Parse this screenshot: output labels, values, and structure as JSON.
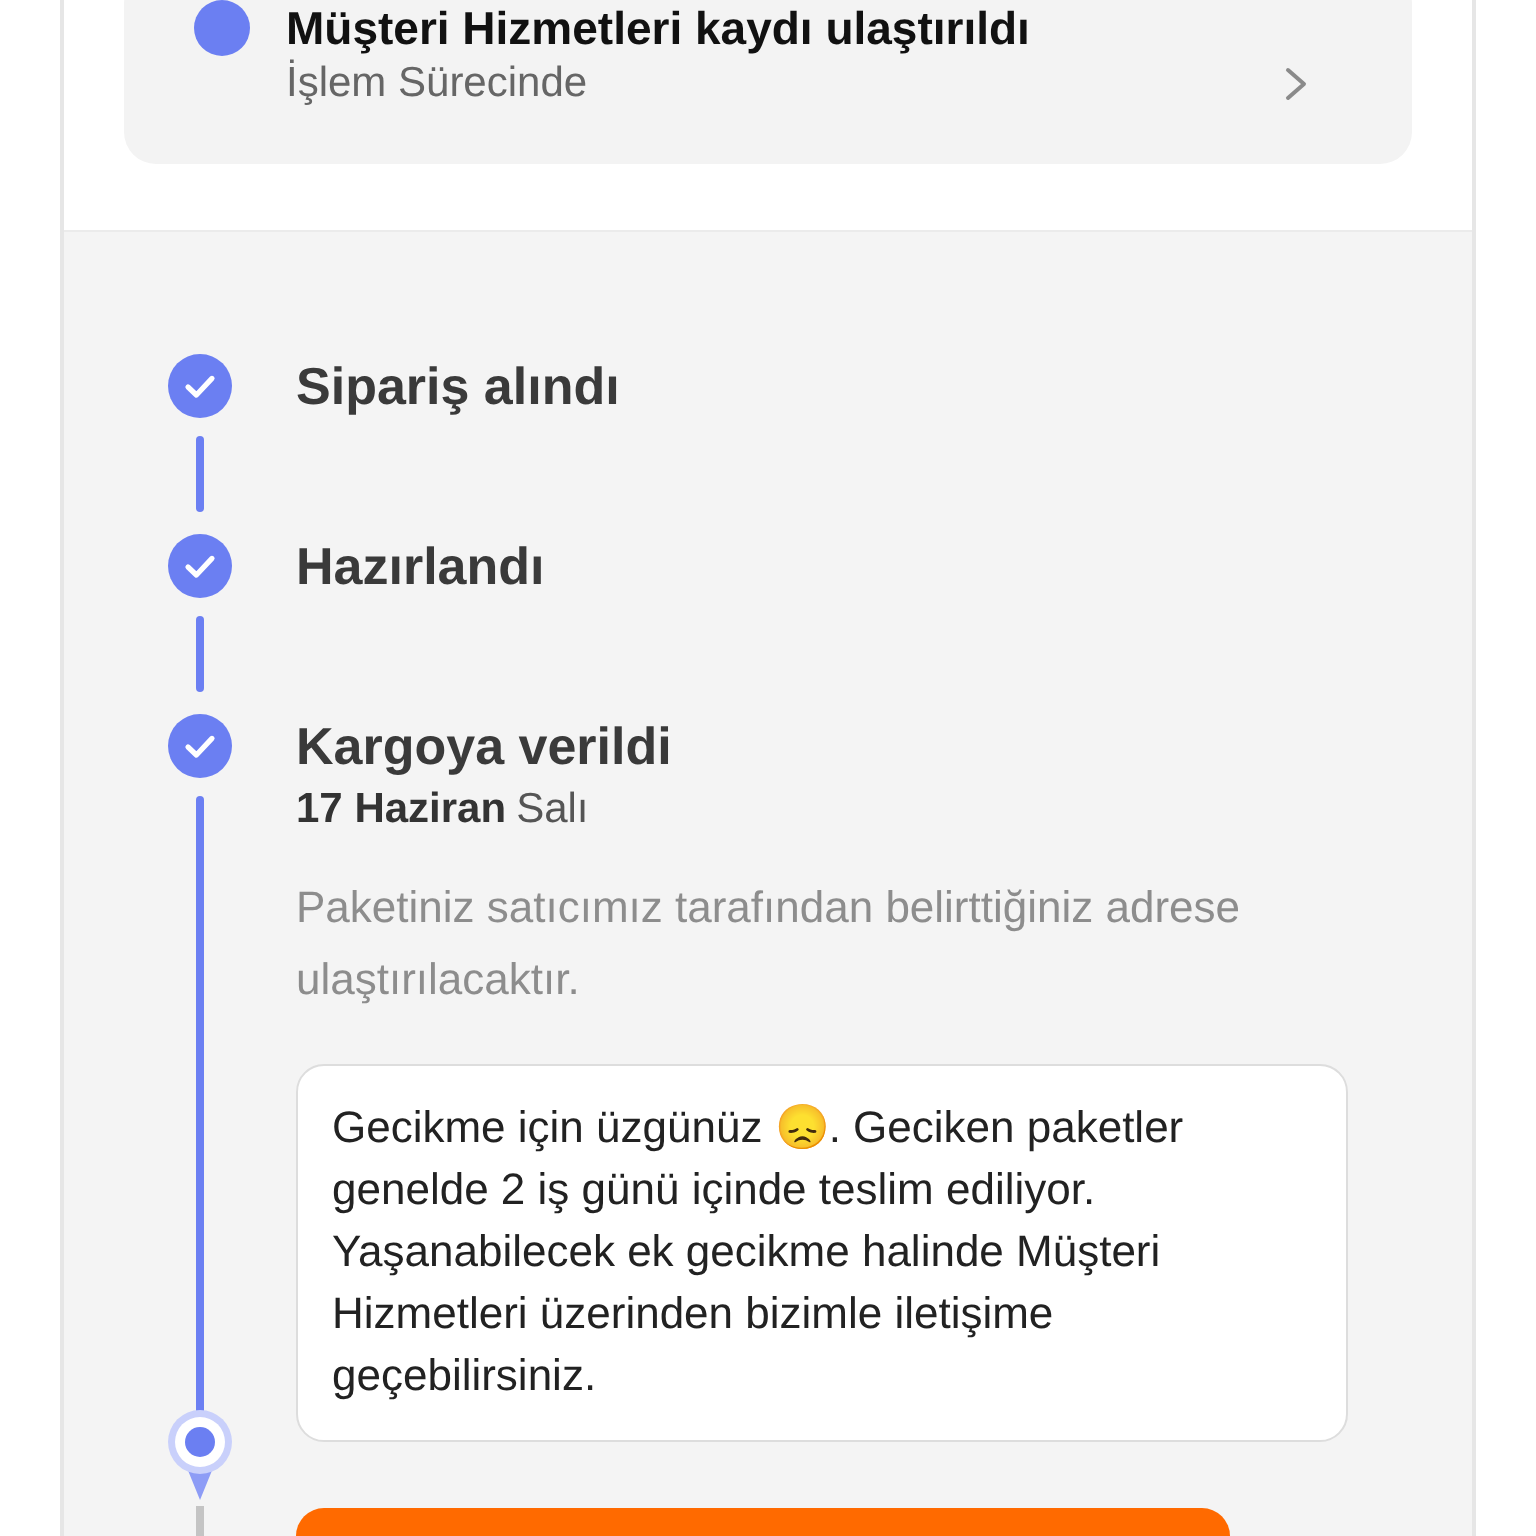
{
  "request_card": {
    "title": "Müşteri Hizmetleri kaydı ulaştırıldı",
    "status": "İşlem Sürecinde"
  },
  "timeline": {
    "steps": [
      {
        "label": "Sipariş alındı",
        "done": true
      },
      {
        "label": "Hazırlandı",
        "done": true
      },
      {
        "label": "Kargoya verildi",
        "done": true,
        "date": "17 Haziran",
        "weekday": "Salı",
        "description": "Paketiniz satıcımız tarafından belirttiğiniz adrese ulaştırılacaktır.",
        "note": "Gecikme için üzgünüz 😞. Geciken paketler genelde 2 iş günü içinde teslim ediliyor. Yaşanabilecek ek gecikme halinde Müşteri Hizmetleri üzerinden bizimle iletişime geçebilirsiniz."
      }
    ]
  }
}
